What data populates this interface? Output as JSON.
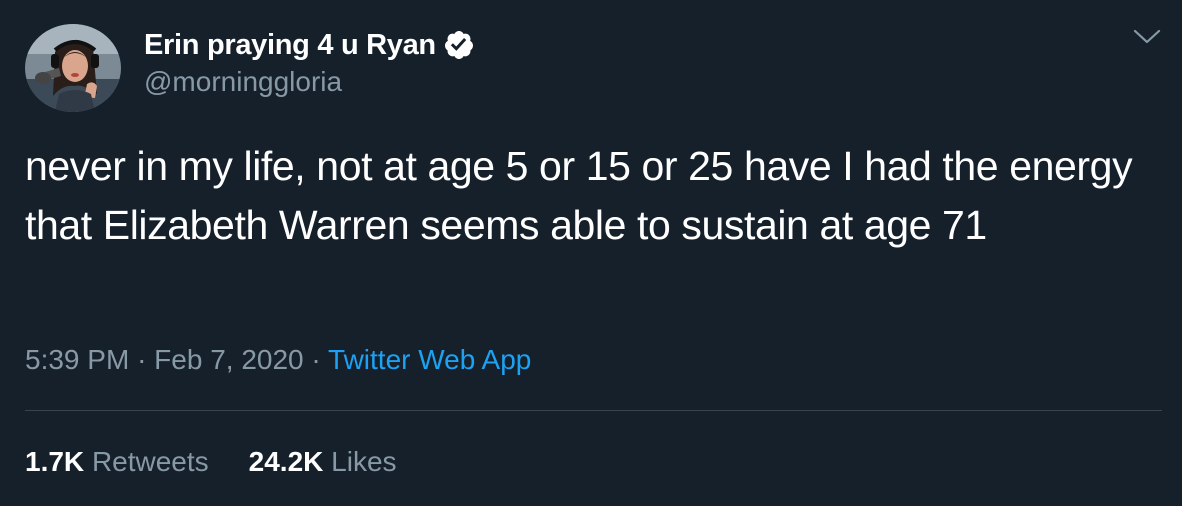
{
  "author": {
    "display_name": "Erin praying 4 u Ryan",
    "handle": "@morninggloria",
    "verified": true
  },
  "tweet": {
    "text": "never in my life, not at age 5 or 15 or 25 have I had the energy that Elizabeth Warren seems able to sustain at age 71",
    "time": "5:39 PM",
    "date": "Feb 7, 2020",
    "separator": "·",
    "source": "Twitter Web App"
  },
  "stats": {
    "retweets_count": "1.7K",
    "retweets_label": "Retweets",
    "likes_count": "24.2K",
    "likes_label": "Likes"
  },
  "icons": {
    "verified": "verified-badge-icon",
    "menu": "chevron-down-icon"
  },
  "colors": {
    "background": "#15202b",
    "text_primary": "#ffffff",
    "text_secondary": "#8899a6",
    "accent": "#1da1f2",
    "divider": "#38444d"
  }
}
